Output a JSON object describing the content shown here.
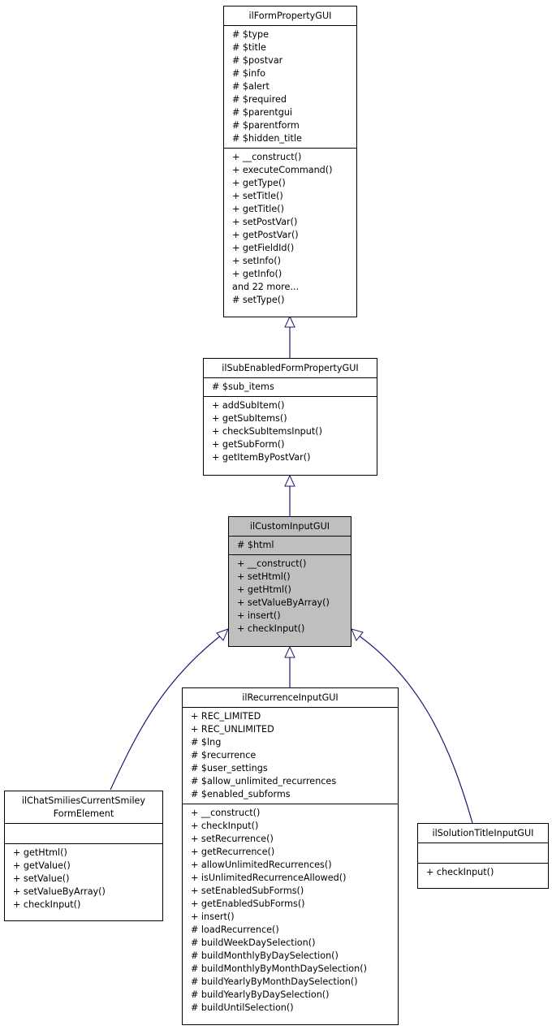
{
  "diagram": {
    "type": "class-inheritance",
    "classes": {
      "formProperty": {
        "name": "ilFormPropertyGUI",
        "attributes": [
          "# $type",
          "# $title",
          "# $postvar",
          "# $info",
          "# $alert",
          "# $required",
          "# $parentgui",
          "# $parentform",
          "# $hidden_title"
        ],
        "methods": [
          "+ __construct()",
          "+ executeCommand()",
          "+ getType()",
          "+ setTitle()",
          "+ getTitle()",
          "+ setPostVar()",
          "+ getPostVar()",
          "+ getFieldId()",
          "+ setInfo()",
          "+ getInfo()",
          "and 22 more...",
          "# setType()"
        ]
      },
      "subEnabled": {
        "name": "ilSubEnabledFormPropertyGUI",
        "attributes": [
          "# $sub_items"
        ],
        "methods": [
          "+ addSubItem()",
          "+ getSubItems()",
          "+ checkSubItemsInput()",
          "+ getSubForm()",
          "+ getItemByPostVar()"
        ]
      },
      "customInput": {
        "name": "ilCustomInputGUI",
        "highlighted": true,
        "attributes": [
          "# $html"
        ],
        "methods": [
          "+ __construct()",
          "+ setHtml()",
          "+ getHtml()",
          "+ setValueByArray()",
          "+ insert()",
          "+ checkInput()"
        ]
      },
      "chatSmilies": {
        "name_line1": "ilChatSmiliesCurrentSmiley",
        "name_line2": "FormElement",
        "attributes": [],
        "methods": [
          "+ getHtml()",
          "+ getValue()",
          "+ setValue()",
          "+ setValueByArray()",
          "+ checkInput()"
        ]
      },
      "recurrence": {
        "name": "ilRecurrenceInputGUI",
        "attributes": [
          "+ REC_LIMITED",
          "+ REC_UNLIMITED",
          "# $lng",
          "# $recurrence",
          "# $user_settings",
          "# $allow_unlimited_recurrences",
          "# $enabled_subforms"
        ],
        "methods": [
          "+ __construct()",
          "+ checkInput()",
          "+ setRecurrence()",
          "+ getRecurrence()",
          "+ allowUnlimitedRecurrences()",
          "+ isUnlimitedRecurrenceAllowed()",
          "+ setEnabledSubForms()",
          "+ getEnabledSubForms()",
          "+ insert()",
          "# loadRecurrence()",
          "# buildWeekDaySelection()",
          "# buildMonthlyByDaySelection()",
          "# buildMonthlyByMonthDaySelection()",
          "# buildYearlyByMonthDaySelection()",
          "# buildYearlyByDaySelection()",
          "# buildUntilSelection()"
        ]
      },
      "solutionTitle": {
        "name": "ilSolutionTitleInputGUI",
        "attributes": [],
        "methods": [
          "+ checkInput()"
        ]
      }
    },
    "edges": [
      {
        "from": "ilSubEnabledFormPropertyGUI",
        "to": "ilFormPropertyGUI",
        "kind": "inheritance"
      },
      {
        "from": "ilCustomInputGUI",
        "to": "ilSubEnabledFormPropertyGUI",
        "kind": "inheritance"
      },
      {
        "from": "ilChatSmiliesCurrentSmileyFormElement",
        "to": "ilCustomInputGUI",
        "kind": "inheritance"
      },
      {
        "from": "ilRecurrenceInputGUI",
        "to": "ilCustomInputGUI",
        "kind": "inheritance"
      },
      {
        "from": "ilSolutionTitleInputGUI",
        "to": "ilCustomInputGUI",
        "kind": "inheritance"
      }
    ],
    "colors": {
      "edge": "#191970",
      "highlight_fill": "#bfbfbf",
      "border": "#000000"
    }
  }
}
